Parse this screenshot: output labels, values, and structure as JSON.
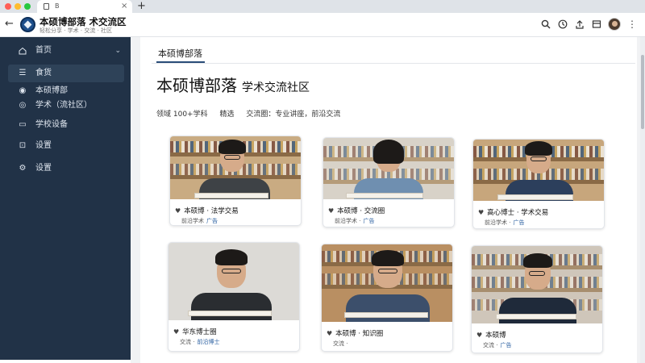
{
  "browser": {
    "tab_title": "B",
    "tab_close": "×",
    "new_tab": "+",
    "traffic_lights": [
      "#ff5f57",
      "#febc2e",
      "#28c840"
    ]
  },
  "site": {
    "title": "本硕博部落 术交流区",
    "subtitle": "轻松分享 · 学术 · 交流 · 社区"
  },
  "header_icons": [
    "search-icon",
    "clock-icon",
    "share-icon",
    "bookmark-icon",
    "avatar",
    "more-icon"
  ],
  "sidebar": {
    "items": [
      {
        "icon": "home-icon",
        "label": "首页",
        "chevron": true
      },
      {
        "icon": "list-icon",
        "label": "食货",
        "active": true
      },
      {
        "icon": "dot-icon",
        "label": "本硕博部"
      },
      {
        "icon": "globe-icon",
        "label": "学术（流社区）"
      },
      {
        "icon": "calendar-icon",
        "label": "学校设备"
      },
      {
        "icon": "lock-icon",
        "label": "设置"
      },
      {
        "icon": "gear-icon",
        "label": "设置"
      }
    ]
  },
  "main": {
    "breadcrumb": "本硕博部落",
    "title": "本硕博部落",
    "title_sub": "学术交流社区",
    "stats": [
      "领域 100+学科",
      "精选",
      "交流圈：专业讲座，前沿交流"
    ]
  },
  "cards": [
    {
      "caption": "本硕博 · 法学交易",
      "meta": "前沿学术",
      "link": "广告"
    },
    {
      "caption": "本硕博 · 交流圈",
      "meta": "前沿学术 ·",
      "link": "广告"
    },
    {
      "caption": "高心博士 · 学术交易",
      "meta": "前沿学术 ·",
      "link": "广告"
    },
    {
      "caption": "华东博士圈",
      "meta": "交流 ·",
      "link": "前沿博士"
    },
    {
      "caption": "本硕博 · 知识圈",
      "meta": "交流 ·",
      "link": ""
    },
    {
      "caption": "本硕博",
      "meta": "交流 ·",
      "link": "广告"
    }
  ],
  "accent_color": "#213247"
}
